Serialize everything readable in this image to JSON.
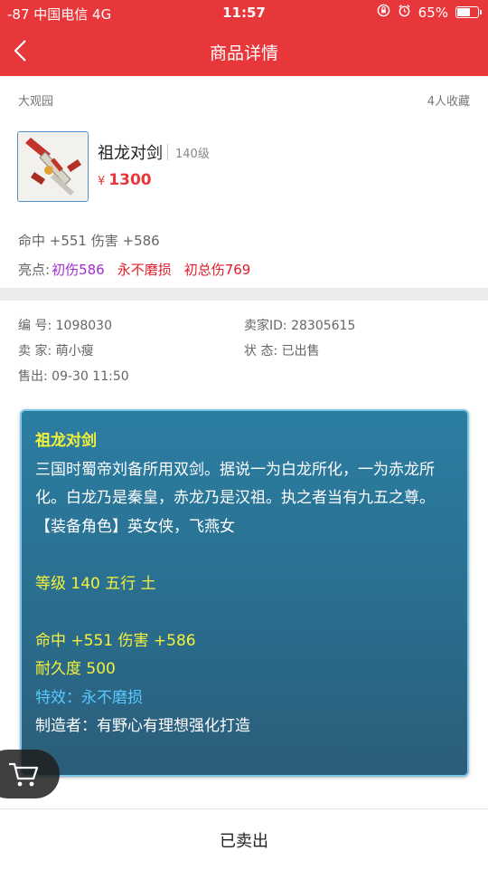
{
  "status_bar": {
    "signal_carrier": "-87 中国电信  4G",
    "time": "11:57",
    "battery_percent": "65%",
    "battery_level": 0.65
  },
  "navbar": {
    "title": "商品详情",
    "back_icon": "chevron-left-icon"
  },
  "shop": {
    "name": "大观园",
    "favorites": "4人收藏"
  },
  "item": {
    "name": "祖龙对剑",
    "level": "140级",
    "price_symbol": "¥",
    "price": "1300",
    "stats": "命中 +551 伤害 +586",
    "highlights_label": "亮点:",
    "highlights": [
      "初伤586",
      "永不磨损",
      "初总伤769"
    ]
  },
  "details": {
    "serial_label": "编  号:",
    "serial": "1098030",
    "seller_id_label": "卖家ID:",
    "seller_id": "28305615",
    "seller_label": "卖  家:",
    "seller": "萌小瘦",
    "state_label": "状  态:",
    "state": "已出售",
    "sale_time_label": "售出:",
    "sale_time": "09-30 11:50"
  },
  "description": {
    "title": "祖龙对剑",
    "text": "三国时蜀帝刘备所用双剑。据说一为白龙所化，一为赤龙所化。白龙乃是秦皇，赤龙乃是汉祖。执之者当有九五之尊。",
    "role": "【装备角色】英女侠，飞燕女",
    "level_element": "等级 140  五行 土",
    "stats": "命中 +551 伤害 +586",
    "durability": "耐久度 500",
    "effect": "特效：永不磨损",
    "maker": "制造者：有野心有理想强化打造"
  },
  "cart": {
    "icon": "cart-icon"
  },
  "bottom": {
    "sold_label": "已卖出"
  },
  "colors": {
    "accent": "#e8373a",
    "purple": "#a32bd1",
    "desc_bg": "#2a6f90",
    "desc_yellow": "#f5f23b",
    "desc_cyan": "#59c8ff"
  }
}
